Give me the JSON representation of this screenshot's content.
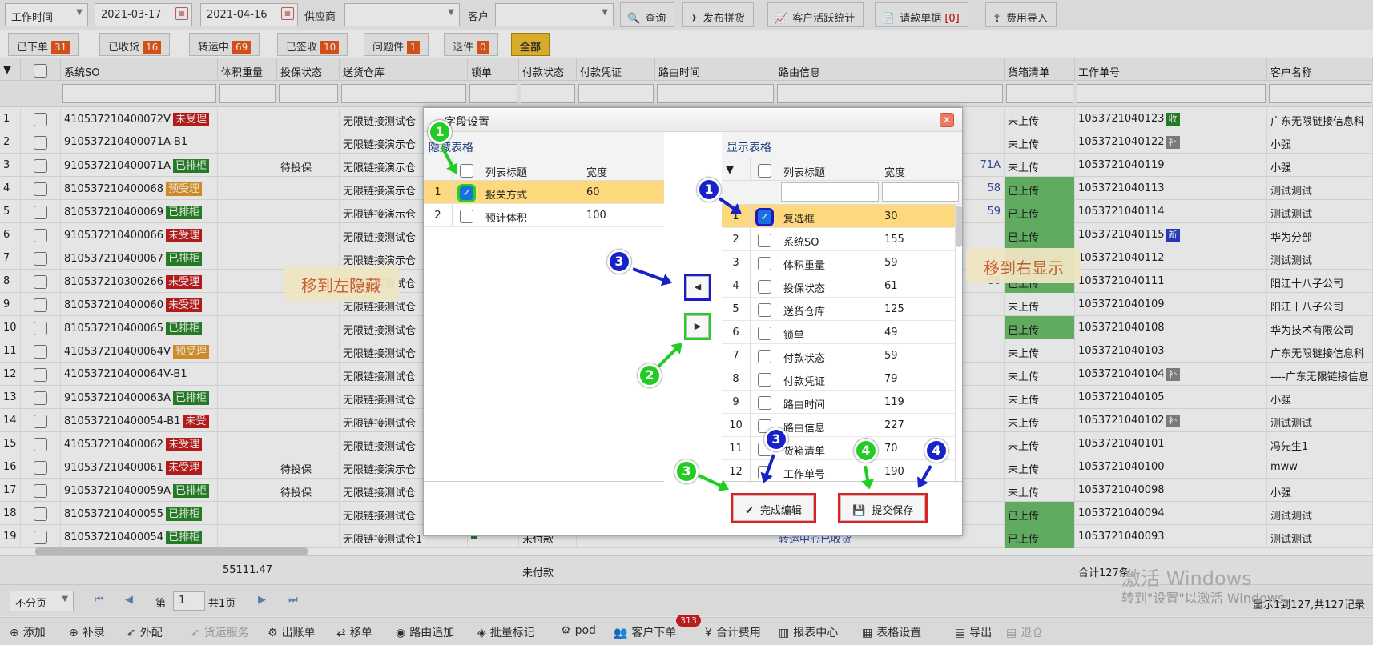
{
  "toolbar": {
    "date_type": "工作时间",
    "date_from": "2021-03-17",
    "date_to": "2021-04-16",
    "supplier_label": "供应商",
    "customer_label": "客户",
    "query": "查询",
    "publish": "发布拼货",
    "customer_stats": "客户活跃统计",
    "payment_request": "请款单据",
    "payment_count": "[0]",
    "fee_import": "费用导入"
  },
  "status_tabs": [
    {
      "label": "已下单",
      "count": "31"
    },
    {
      "label": "已收货",
      "count": "16"
    },
    {
      "label": "转运中",
      "count": "69"
    },
    {
      "label": "已签收",
      "count": "10"
    },
    {
      "label": "问题件",
      "count": "1"
    },
    {
      "label": "退件",
      "count": "0"
    },
    {
      "label": "全部",
      "count": ""
    }
  ],
  "grid": {
    "headers": {
      "so": "系统SO",
      "volume": "体积重量",
      "insure": "投保状态",
      "warehouse": "送货仓库",
      "lock": "锁单",
      "pay_status": "付款状态",
      "pay_voucher": "付款凭证",
      "route_time": "路由时间",
      "route_info": "路由信息",
      "packing": "货箱清单",
      "work_no": "工作单号",
      "customer": "客户名称"
    },
    "rows": [
      {
        "n": "1",
        "so": "410537210400072V",
        "tag": "未受理",
        "tc": "red",
        "ins": "",
        "wh": "无限链接测试仓",
        "ri": "",
        "pk": "未上传",
        "wn": "1053721040123",
        "wb": "收",
        "wbc": "g",
        "cu": "广东无限链接信息科"
      },
      {
        "n": "2",
        "so": "910537210400071A-B1",
        "tag": "",
        "tc": "",
        "ins": "",
        "wh": "无限链接演示仓",
        "ri": "",
        "pk": "未上传",
        "wn": "1053721040122",
        "wb": "补",
        "wbc": "gray",
        "cu": "小强"
      },
      {
        "n": "3",
        "so": "910537210400071A",
        "tag": "已排柜",
        "tc": "green",
        "ins": "待投保",
        "wh": "无限链接演示仓",
        "ri": "71A",
        "pk": "未上传",
        "wn": "1053721040119",
        "wb": "",
        "wbc": "",
        "cu": "小强"
      },
      {
        "n": "4",
        "so": "810537210400068",
        "tag": "预受理",
        "tc": "orange",
        "ins": "",
        "wh": "无限链接演示仓",
        "ri": "58",
        "pk": "已上传",
        "wn": "1053721040113",
        "wb": "",
        "wbc": "",
        "cu": "测试测试"
      },
      {
        "n": "5",
        "so": "810537210400069",
        "tag": "已排柜",
        "tc": "green",
        "ins": "",
        "wh": "无限链接演示仓",
        "ri": "59",
        "pk": "已上传",
        "wn": "1053721040114",
        "wb": "",
        "wbc": "",
        "cu": "测试测试"
      },
      {
        "n": "6",
        "so": "910537210400066",
        "tag": "未受理",
        "tc": "red",
        "ins": "",
        "wh": "无限链接测试仓",
        "ri": "",
        "pk": "已上传",
        "wn": "1053721040115",
        "wb": "新",
        "wbc": "b",
        "cu": "华为分部"
      },
      {
        "n": "7",
        "so": "810537210400067",
        "tag": "已排柜",
        "tc": "green",
        "ins": "",
        "wh": "无限链接演示仓",
        "ri": "",
        "pk": "已上传",
        "wn": "1053721040112",
        "wb": "",
        "wbc": "",
        "cu": "测试测试"
      },
      {
        "n": "8",
        "so": "810537210300266",
        "tag": "未受理",
        "tc": "red",
        "ins": "",
        "wh": "无限链接测试仓",
        "ri": "66",
        "pk": "已上传",
        "wn": "1053721040111",
        "wb": "",
        "wbc": "",
        "cu": "阳江十八子公司"
      },
      {
        "n": "9",
        "so": "810537210400060",
        "tag": "未受理",
        "tc": "red",
        "ins": "",
        "wh": "无限链接测试仓",
        "ri": "",
        "pk": "未上传",
        "wn": "1053721040109",
        "wb": "",
        "wbc": "",
        "cu": "阳江十八子公司"
      },
      {
        "n": "10",
        "so": "810537210400065",
        "tag": "已排柜",
        "tc": "green",
        "ins": "",
        "wh": "无限链接测试仓",
        "ri": "",
        "pk": "已上传",
        "wn": "1053721040108",
        "wb": "",
        "wbc": "",
        "cu": "华为技术有限公司"
      },
      {
        "n": "11",
        "so": "410537210400064V",
        "tag": "预受理",
        "tc": "orange",
        "ins": "",
        "wh": "无限链接测试仓",
        "ri": "",
        "pk": "未上传",
        "wn": "1053721040103",
        "wb": "",
        "wbc": "",
        "cu": "广东无限链接信息科"
      },
      {
        "n": "12",
        "so": "410537210400064V-B1",
        "tag": "",
        "tc": "",
        "ins": "",
        "wh": "无限链接测试仓",
        "ri": "",
        "pk": "未上传",
        "wn": "1053721040104",
        "wb": "补",
        "wbc": "gray",
        "cu": "----广东无限链接信息"
      },
      {
        "n": "13",
        "so": "910537210400063A",
        "tag": "已排柜",
        "tc": "green",
        "ins": "",
        "wh": "无限链接测试仓",
        "ri": "",
        "pk": "未上传",
        "wn": "1053721040105",
        "wb": "",
        "wbc": "",
        "cu": "小强"
      },
      {
        "n": "14",
        "so": "810537210400054-B1",
        "tag": "未受",
        "tc": "red",
        "ins": "",
        "wh": "无限链接测试仓",
        "ri": "",
        "pk": "未上传",
        "wn": "1053721040102",
        "wb": "补",
        "wbc": "gray",
        "cu": "测试测试"
      },
      {
        "n": "15",
        "so": "410537210400062",
        "tag": "未受理",
        "tc": "red",
        "ins": "",
        "wh": "无限链接测试仓",
        "ri": "",
        "pk": "未上传",
        "wn": "1053721040101",
        "wb": "",
        "wbc": "",
        "cu": "冯先生1"
      },
      {
        "n": "16",
        "so": "910537210400061",
        "tag": "未受理",
        "tc": "red",
        "ins": "待投保",
        "wh": "无限链接演示仓",
        "ri": "",
        "pk": "未上传",
        "wn": "1053721040100",
        "wb": "",
        "wbc": "",
        "cu": "mww"
      },
      {
        "n": "17",
        "so": "910537210400059A",
        "tag": "已排柜",
        "tc": "green",
        "ins": "待投保",
        "wh": "无限链接测试仓",
        "ri": "",
        "pk": "未上传",
        "wn": "1053721040098",
        "wb": "",
        "wbc": "",
        "cu": "小强"
      },
      {
        "n": "18",
        "so": "810537210400055",
        "tag": "已排柜",
        "tc": "green",
        "ins": "",
        "wh": "无限链接测试仓",
        "ri": "",
        "pk": "已上传",
        "wn": "1053721040094",
        "wb": "",
        "wbc": "",
        "cu": "测试测试"
      },
      {
        "n": "19",
        "so": "810537210400054",
        "tag": "已排柜",
        "tc": "green",
        "ins": "",
        "wh": "无限链接测试仓1",
        "ri": "转运中心已收货",
        "pk": "已上传",
        "wn": "1053721040093",
        "wb": "",
        "wbc": "",
        "cu": "测试测试"
      }
    ],
    "last_pay": "未付款",
    "sum_volume": "55111.47",
    "sum_pay": "未付款",
    "sum_total": "合计127条"
  },
  "pager": {
    "page_size": "不分页",
    "page_label": "第",
    "page": "1",
    "total_pages": "共1页",
    "record_info": "显示1到127,共127记录"
  },
  "bottom": {
    "add": "添加",
    "supplement": "补录",
    "dispatch": "外配",
    "freight": "货运服务",
    "bill": "出账单",
    "move": "移单",
    "route_add": "路由追加",
    "batch_mark": "批量标记",
    "pod": "pod",
    "customer_order": "客户下单",
    "order_badge": "313",
    "total_fee": "合计费用",
    "report": "报表中心",
    "table_settings": "表格设置",
    "export": "导出",
    "return": "退仓"
  },
  "dialog": {
    "title": "字段设置",
    "hidden_title": "隐藏表格",
    "shown_title": "显示表格",
    "col_title": "列表标题",
    "col_width": "宽度",
    "hidden_rows": [
      {
        "n": "1",
        "title": "报关方式",
        "width": "60"
      },
      {
        "n": "2",
        "title": "预计体积",
        "width": "100"
      }
    ],
    "shown_rows": [
      {
        "n": "1",
        "title": "复选框",
        "width": "30"
      },
      {
        "n": "2",
        "title": "系统SO",
        "width": "155"
      },
      {
        "n": "3",
        "title": "体积重量",
        "width": "59"
      },
      {
        "n": "4",
        "title": "投保状态",
        "width": "61"
      },
      {
        "n": "5",
        "title": "送货仓库",
        "width": "125"
      },
      {
        "n": "6",
        "title": "锁单",
        "width": "49"
      },
      {
        "n": "7",
        "title": "付款状态",
        "width": "59"
      },
      {
        "n": "8",
        "title": "付款凭证",
        "width": "79"
      },
      {
        "n": "9",
        "title": "路由时间",
        "width": "119"
      },
      {
        "n": "10",
        "title": "路由信息",
        "width": "227"
      },
      {
        "n": "11",
        "title": "货箱清单",
        "width": "70"
      },
      {
        "n": "12",
        "title": "工作单号",
        "width": "190"
      }
    ],
    "finish_edit": "完成编辑",
    "submit_save": "提交保存"
  },
  "annotations": {
    "move_left": "移到左隐藏",
    "move_right": "移到右显示",
    "c1": "1",
    "c2": "2",
    "c3": "3",
    "c4": "4"
  },
  "watermark": {
    "line1": "激活 Windows",
    "line2": "转到\"设置\"以激活 Windows。"
  }
}
